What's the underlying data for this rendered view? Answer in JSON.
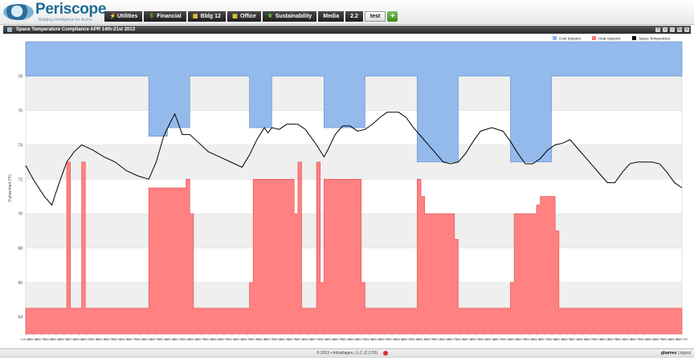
{
  "app": {
    "name": "Periscope",
    "tagline": "Building Intelligence for Action"
  },
  "nav": {
    "tabs": [
      {
        "label": "Utilities",
        "icon": "lightning-icon"
      },
      {
        "label": "Financial",
        "icon": "dollar-icon"
      },
      {
        "label": "Bldg 12",
        "icon": "building-icon"
      },
      {
        "label": "Office",
        "icon": "building-icon"
      },
      {
        "label": "Sustainability",
        "icon": "leaf-icon"
      },
      {
        "label": "Media",
        "icon": ""
      },
      {
        "label": "2.2",
        "icon": ""
      },
      {
        "label": "test",
        "icon": "",
        "active": true
      }
    ],
    "add_label": "+"
  },
  "panel": {
    "title": "Space Temperature Compliance APR 14th-21st 2013"
  },
  "footer": {
    "copyright": "© 2013 • Arkadiagen, LLC (2.2.55)",
    "user": "gbarnes",
    "logout": "logout"
  },
  "colors": {
    "cool": "#8db6ea",
    "heat": "#ff7a7a",
    "temp": "#000000",
    "panel_bar": "#3b3b3b",
    "band": "#efefef"
  },
  "chart_data": {
    "type": "area",
    "title": "",
    "ylabel": "Fahrenheit (°F)",
    "ylim": [
      63,
      80
    ],
    "yticks": [
      64,
      66,
      68,
      70,
      72,
      74,
      76,
      78
    ],
    "legend_position": "top-right",
    "legend": [
      "Cool Setpoint",
      "Heat Setpoint",
      "Space Temperature"
    ],
    "x_tick_labels": [
      "1:00 AM",
      "9:00 AM",
      "5:00 PM",
      "1:00 AM",
      "9:00 AM",
      "5:00 PM",
      "1:00 AM",
      "9:00 AM",
      "5:00 PM",
      "1:00 AM",
      "9:00 AM",
      "5:00 PM",
      "1:00 AM",
      "9:00 AM",
      "5:00 PM",
      "1:00 AM",
      "9:00 AM",
      "5:00 PM",
      "1:00 AM",
      "9:00 AM",
      "5:00 PM",
      "1:00 AM",
      "9:00 AM",
      "5:00 PM",
      "1:00 AM",
      "9:00 AM",
      "5:00 PM",
      "1:00 AM",
      "9:00 AM",
      "5:00 PM",
      "1:00 AM",
      "9:00 AM",
      "5:00 PM",
      "1:00 AM",
      "9:00 AM",
      "5:00 PM",
      "1:00 AM",
      "9:00 AM",
      "5:00 PM",
      "1:00 AM",
      "9:00 AM",
      "5:00 PM",
      "1:00 AM",
      "9:00 AM",
      "5:00 PM",
      "1:00 AM",
      "9:00 AM",
      "5:00 PM",
      "1:00 AM",
      "9:00 AM",
      "5:00 PM",
      "1:00 AM",
      "9:00 AM",
      "5:00 PM",
      "1:00 AM",
      "9:00 AM",
      "5:00 PM",
      "1:00 AM",
      "9:00 AM",
      "5:00 PM",
      "1:00 AM",
      "9:00 AM",
      "5:00 PM",
      "1:00 AM",
      "9:00 AM",
      "5:00 PM",
      "1:00 AM",
      "9:00 AM",
      "5:00 PM",
      "1:00 AM",
      "9:00 AM",
      "5:00 PM",
      "1:00 AM",
      "9:00 AM",
      "5:00 PM",
      "1:00 AM",
      "9:00 AM",
      "5:00 PM",
      "1:00 AM",
      "9:00 AM",
      "5:00 PM",
      "1:00 AM",
      "9:00 AM",
      "5:00 PM",
      "1:00 AM",
      "9:00 AM",
      "5:00 PM"
    ],
    "hours_span": 176,
    "series": [
      {
        "name": "Cool Setpoint",
        "color": "#8db6ea",
        "fill_to": "top",
        "points": [
          [
            0,
            78
          ],
          [
            33,
            78
          ],
          [
            33,
            74.5
          ],
          [
            38,
            74.5
          ],
          [
            38,
            75
          ],
          [
            44,
            75
          ],
          [
            44,
            78
          ],
          [
            60,
            78
          ],
          [
            60,
            75
          ],
          [
            66,
            75
          ],
          [
            66,
            78
          ],
          [
            80,
            78
          ],
          [
            80,
            75
          ],
          [
            91,
            75
          ],
          [
            91,
            78
          ],
          [
            105,
            78
          ],
          [
            105,
            73
          ],
          [
            116,
            73
          ],
          [
            116,
            78
          ],
          [
            130,
            78
          ],
          [
            130,
            73
          ],
          [
            141,
            73
          ],
          [
            141,
            78
          ],
          [
            176,
            78
          ]
        ]
      },
      {
        "name": "Heat Setpoint",
        "color": "#ff7a7a",
        "points": [
          [
            0,
            64.5
          ],
          [
            11,
            64.5
          ],
          [
            11,
            73
          ],
          [
            12,
            73
          ],
          [
            12,
            64.5
          ],
          [
            15,
            64.5
          ],
          [
            15,
            73
          ],
          [
            16,
            73
          ],
          [
            16,
            64.5
          ],
          [
            33,
            64.5
          ],
          [
            33,
            71.5
          ],
          [
            43,
            71.5
          ],
          [
            43,
            72
          ],
          [
            44,
            72
          ],
          [
            44,
            70
          ],
          [
            45,
            70
          ],
          [
            45,
            64.5
          ],
          [
            60,
            64.5
          ],
          [
            60,
            66
          ],
          [
            61,
            66
          ],
          [
            61,
            72
          ],
          [
            72,
            72
          ],
          [
            72,
            70
          ],
          [
            73,
            70
          ],
          [
            73,
            73
          ],
          [
            74,
            73
          ],
          [
            74,
            64.5
          ],
          [
            78,
            64.5
          ],
          [
            78,
            73
          ],
          [
            79,
            73
          ],
          [
            79,
            66
          ],
          [
            80,
            66
          ],
          [
            80,
            72
          ],
          [
            90,
            72
          ],
          [
            90,
            66
          ],
          [
            91,
            66
          ],
          [
            91,
            64.5
          ],
          [
            105,
            64.5
          ],
          [
            105,
            72
          ],
          [
            106,
            72
          ],
          [
            106,
            71
          ],
          [
            107,
            71
          ],
          [
            107,
            70
          ],
          [
            115,
            70
          ],
          [
            115,
            68.5
          ],
          [
            116,
            68.5
          ],
          [
            116,
            64.5
          ],
          [
            130,
            64.5
          ],
          [
            130,
            66
          ],
          [
            131,
            66
          ],
          [
            131,
            70
          ],
          [
            137,
            70
          ],
          [
            137,
            70.5
          ],
          [
            138,
            70.5
          ],
          [
            138,
            71
          ],
          [
            142,
            71
          ],
          [
            142,
            69
          ],
          [
            143,
            69
          ],
          [
            143,
            64.5
          ],
          [
            176,
            64.5
          ]
        ]
      },
      {
        "name": "Space Temperature",
        "color": "#000000",
        "points": [
          [
            0,
            72.8
          ],
          [
            2,
            72
          ],
          [
            5,
            71
          ],
          [
            7,
            70.5
          ],
          [
            9,
            71.8
          ],
          [
            11,
            73
          ],
          [
            13,
            73.6
          ],
          [
            15,
            74
          ],
          [
            18,
            73.7
          ],
          [
            21,
            73.3
          ],
          [
            24,
            73
          ],
          [
            27,
            72.5
          ],
          [
            30,
            72.2
          ],
          [
            33,
            72
          ],
          [
            35,
            73
          ],
          [
            37,
            74.5
          ],
          [
            39,
            75.4
          ],
          [
            40,
            75.8
          ],
          [
            41,
            75.2
          ],
          [
            42,
            74.6
          ],
          [
            44,
            74.6
          ],
          [
            46,
            74.2
          ],
          [
            49,
            73.6
          ],
          [
            52,
            73.3
          ],
          [
            55,
            73
          ],
          [
            58,
            72.7
          ],
          [
            60,
            73.4
          ],
          [
            62,
            74.3
          ],
          [
            64,
            75
          ],
          [
            65,
            74.7
          ],
          [
            66,
            75
          ],
          [
            68,
            74.9
          ],
          [
            70,
            75.2
          ],
          [
            73,
            75.2
          ],
          [
            75,
            74.9
          ],
          [
            78,
            74
          ],
          [
            80,
            73.3
          ],
          [
            81,
            73.7
          ],
          [
            83,
            74.6
          ],
          [
            85,
            75.1
          ],
          [
            87,
            75.1
          ],
          [
            89,
            74.8
          ],
          [
            91,
            74.9
          ],
          [
            93,
            75.2
          ],
          [
            95,
            75.6
          ],
          [
            97,
            75.9
          ],
          [
            100,
            75.9
          ],
          [
            102,
            75.6
          ],
          [
            104,
            75
          ],
          [
            106,
            74.5
          ],
          [
            108,
            74
          ],
          [
            110,
            73.5
          ],
          [
            112,
            73
          ],
          [
            114,
            72.9
          ],
          [
            116,
            73
          ],
          [
            118,
            73.5
          ],
          [
            120,
            74.2
          ],
          [
            122,
            74.8
          ],
          [
            125,
            75
          ],
          [
            128,
            74.8
          ],
          [
            130,
            74.2
          ],
          [
            132,
            73.5
          ],
          [
            134,
            72.9
          ],
          [
            136,
            72.9
          ],
          [
            138,
            73.2
          ],
          [
            140,
            73.7
          ],
          [
            142,
            74
          ],
          [
            144,
            74.1
          ],
          [
            146,
            74.3
          ],
          [
            148,
            73.8
          ],
          [
            150,
            73.3
          ],
          [
            152,
            72.8
          ],
          [
            154,
            72.3
          ],
          [
            156,
            71.8
          ],
          [
            158,
            71.8
          ],
          [
            160,
            72.4
          ],
          [
            162,
            72.9
          ],
          [
            164,
            73
          ],
          [
            166,
            73
          ],
          [
            168,
            73
          ],
          [
            170,
            72.9
          ],
          [
            172,
            72.4
          ],
          [
            174,
            71.8
          ],
          [
            176,
            71.5
          ]
        ]
      }
    ]
  }
}
